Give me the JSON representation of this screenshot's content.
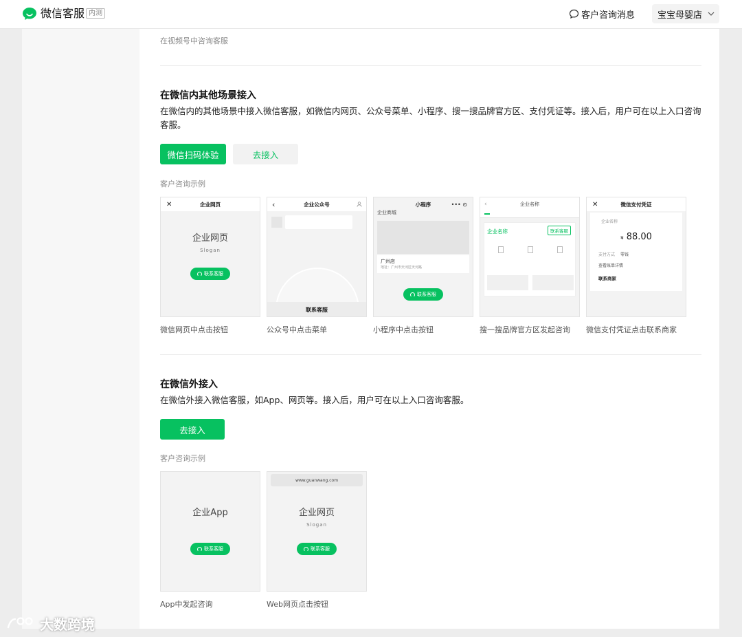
{
  "header": {
    "brand": "微信客服",
    "beta_badge": "内测",
    "messages_link": "客户咨询消息",
    "store_name": "宝宝母婴店"
  },
  "top_section": {
    "caption": "在视频号中咨询客服"
  },
  "section_in_wechat": {
    "title": "在微信内其他场景接入",
    "description": "在微信内的其他场景中接入微信客服，如微信内网页、公众号菜单、小程序、搜一搜品牌官方区、支付凭证等。接入后，用户可在以上入口咨询客服。",
    "btn_scan": "微信扫码体验",
    "btn_connect": "去接入",
    "examples_label": "客户咨询示例",
    "cards": [
      {
        "caption": "微信网页中点击按钮",
        "bar_title": "企业网页",
        "title": "企业网页",
        "slogan": "Slogan",
        "pill": "联系客服"
      },
      {
        "caption": "公众号中点击菜单",
        "bar_title": "企业公众号",
        "menu_label": "联系客服"
      },
      {
        "caption": "小程序中点击按钮",
        "bar_title": "小程序",
        "shop_label": "企业商城",
        "store_name": "广州店",
        "store_addr": "地址：广州市天河区天河路",
        "pill": "联系客服"
      },
      {
        "caption": "搜一搜品牌官方区发起咨询",
        "search_title": "企业名称",
        "brand_name": "企业名称",
        "contact": "联系客服"
      },
      {
        "caption": "微信支付凭证点击联系商家",
        "bar_title": "微信支付凭证",
        "merchant": "企业名称",
        "amount": "88.00",
        "currency": "¥",
        "pay_label": "支付方式",
        "pay_value": "零钱",
        "detail_label": "查看账单详情",
        "contact": "联系商家"
      }
    ]
  },
  "section_outside": {
    "title": "在微信外接入",
    "description": "在微信外接入微信客服，如App、网页等。接入后，用户可在以上入口咨询客服。",
    "btn_connect": "去接入",
    "examples_label": "客户咨询示例",
    "cards": [
      {
        "caption": "App中发起咨询",
        "title": "企业App",
        "pill": "联系客服"
      },
      {
        "caption": "Web网页点击按钮",
        "url": "www.guanwang.com",
        "title": "企业网页",
        "slogan": "Slogan",
        "pill": "联系客服"
      }
    ]
  },
  "watermark": "大数跨境",
  "colors": {
    "accent": "#07c160",
    "background": "#ededed"
  }
}
